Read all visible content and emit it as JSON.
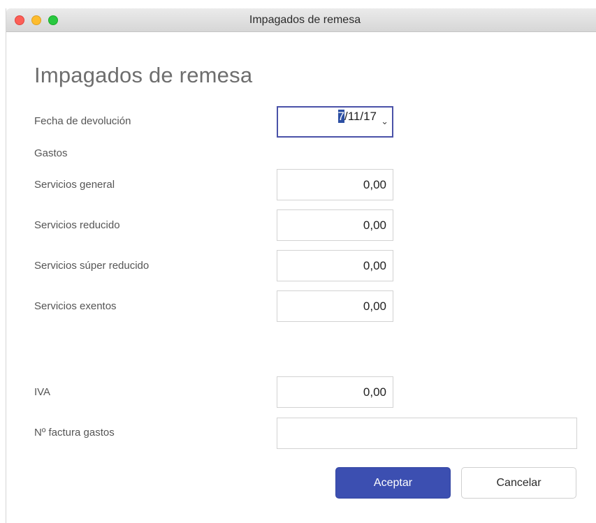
{
  "window": {
    "title": "Impagados de remesa"
  },
  "heading": "Impagados de remesa",
  "form": {
    "fecha_label": "Fecha de devolución",
    "fecha_selected": "7",
    "fecha_rest": "/11/17",
    "gastos_label": "Gastos",
    "servicios_general_label": "Servicios general",
    "servicios_general_value": "0,00",
    "servicios_reducido_label": "Servicios reducido",
    "servicios_reducido_value": "0,00",
    "servicios_super_label": "Servicios súper reducido",
    "servicios_super_value": "0,00",
    "servicios_exentos_label": "Servicios exentos",
    "servicios_exentos_value": "0,00",
    "iva_label": "IVA",
    "iva_value": "0,00",
    "factura_label": "Nº factura gastos",
    "factura_value": ""
  },
  "buttons": {
    "ok": "Aceptar",
    "cancel": "Cancelar"
  },
  "icons": {
    "chevron": "chevron-down-icon"
  },
  "colors": {
    "accent": "#3c4fb1",
    "focus_border": "#4a52a8",
    "close": "#fc5f57",
    "minimize": "#fdbc2e",
    "maximize": "#29c840"
  }
}
